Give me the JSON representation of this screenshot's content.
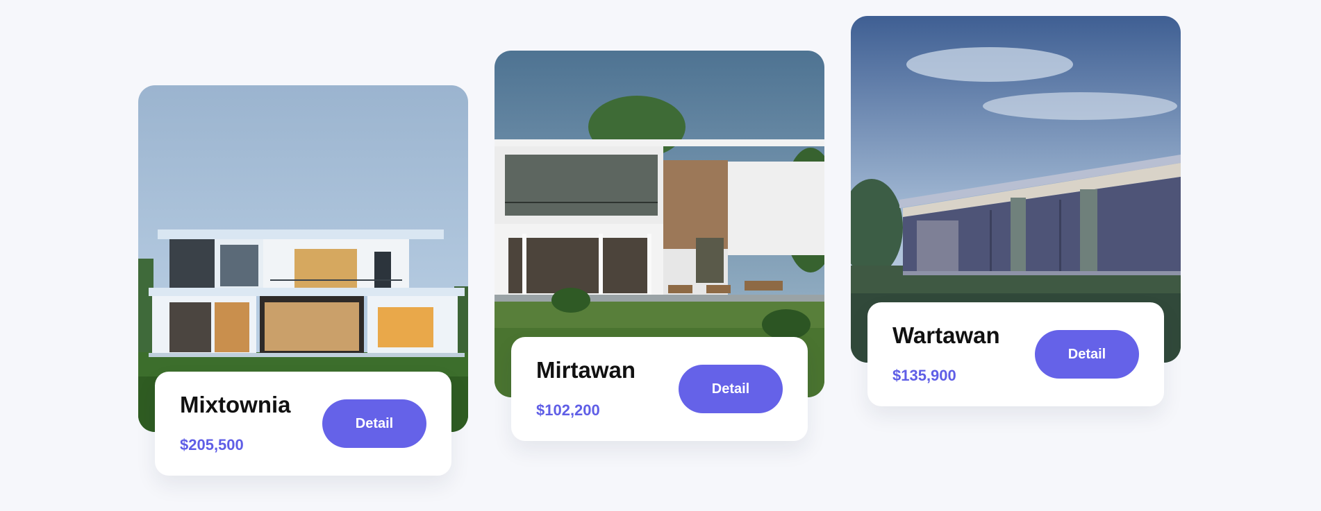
{
  "listings": [
    {
      "name": "Mixtownia",
      "price": "$205,500",
      "button_label": "Detail"
    },
    {
      "name": "Mirtawan",
      "price": "$102,200",
      "button_label": "Detail"
    },
    {
      "name": "Wartawan",
      "price": "$135,900",
      "button_label": "Detail"
    }
  ],
  "colors": {
    "accent": "#6562e8",
    "price_text": "#5f5ee6",
    "page_background": "#f6f7fb",
    "card_background": "#ffffff"
  }
}
